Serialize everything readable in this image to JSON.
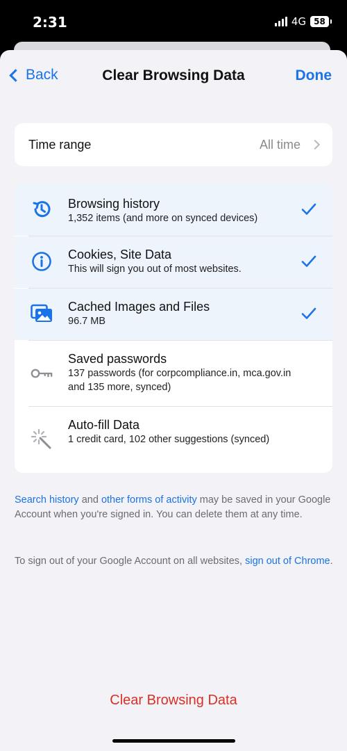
{
  "status": {
    "time": "2:31",
    "network": "4G",
    "battery": "58"
  },
  "nav": {
    "back_label": "Back",
    "title": "Clear Browsing Data",
    "done_label": "Done"
  },
  "time_range": {
    "label": "Time range",
    "value": "All time"
  },
  "items": [
    {
      "title": "Browsing history",
      "subtitle": "1,352 items (and more on synced devices)",
      "icon": "history-icon",
      "selected": true
    },
    {
      "title": "Cookies, Site Data",
      "subtitle": "This will sign you out of most websites.",
      "icon": "info-icon",
      "selected": true
    },
    {
      "title": "Cached Images and Files",
      "subtitle": "96.7 MB",
      "icon": "images-icon",
      "selected": true
    },
    {
      "title": "Saved passwords",
      "subtitle": "137 passwords (for corpcompliance.in, mca.gov.in and 135 more, synced)",
      "icon": "key-icon",
      "selected": false
    },
    {
      "title": "Auto-fill Data",
      "subtitle": "1 credit card, 102 other suggestions (synced)",
      "icon": "magic-wand-icon",
      "selected": false
    }
  ],
  "footer1": {
    "link1": "Search history",
    "text1": " and ",
    "link2": "other forms of activity",
    "text2": " may be saved in your Google Account when you're signed in. You can delete them at any time."
  },
  "footer2": {
    "text1": "To sign out of your Google Account on all websites, ",
    "link1": "sign out of Chrome",
    "text2": "."
  },
  "clear_button": "Clear Browsing Data",
  "colors": {
    "accent": "#1a73e8",
    "destructive": "#d93025",
    "selected_row": "#edf4fc",
    "background": "#f2f2f7"
  }
}
